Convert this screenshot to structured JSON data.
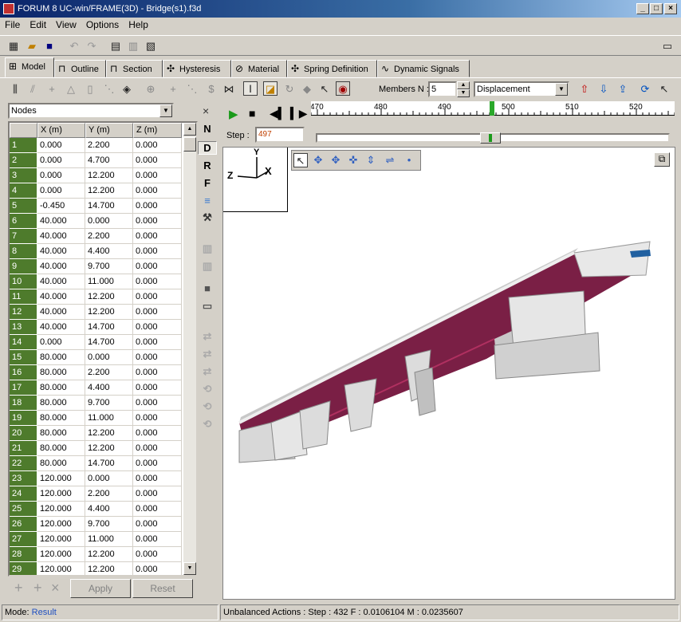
{
  "window": {
    "title": "FORUM 8  UC-win/FRAME(3D) - Bridge(s1).f3d"
  },
  "menu": [
    "File",
    "Edit",
    "View",
    "Options",
    "Help"
  ],
  "tabs": [
    "Model",
    "Outline",
    "Section",
    "Hysteresis",
    "Material",
    "Spring Definition",
    "Dynamic Signals"
  ],
  "toolbar2": {
    "members_label": "Members N :",
    "members_value": "5",
    "result_type": "Displacement"
  },
  "left": {
    "list_select": "Nodes",
    "close": "×",
    "columns": [
      "",
      "X (m)",
      "Y (m)",
      "Z (m)"
    ],
    "rows": [
      [
        "1",
        "0.000",
        "2.200",
        "0.000"
      ],
      [
        "2",
        "0.000",
        "4.700",
        "0.000"
      ],
      [
        "3",
        "0.000",
        "12.200",
        "0.000"
      ],
      [
        "4",
        "0.000",
        "12.200",
        "0.000"
      ],
      [
        "5",
        "-0.450",
        "14.700",
        "0.000"
      ],
      [
        "6",
        "40.000",
        "0.000",
        "0.000"
      ],
      [
        "7",
        "40.000",
        "2.200",
        "0.000"
      ],
      [
        "8",
        "40.000",
        "4.400",
        "0.000"
      ],
      [
        "9",
        "40.000",
        "9.700",
        "0.000"
      ],
      [
        "10",
        "40.000",
        "11.000",
        "0.000"
      ],
      [
        "11",
        "40.000",
        "12.200",
        "0.000"
      ],
      [
        "12",
        "40.000",
        "12.200",
        "0.000"
      ],
      [
        "13",
        "40.000",
        "14.700",
        "0.000"
      ],
      [
        "14",
        "0.000",
        "14.700",
        "0.000"
      ],
      [
        "15",
        "80.000",
        "0.000",
        "0.000"
      ],
      [
        "16",
        "80.000",
        "2.200",
        "0.000"
      ],
      [
        "17",
        "80.000",
        "4.400",
        "0.000"
      ],
      [
        "18",
        "80.000",
        "9.700",
        "0.000"
      ],
      [
        "19",
        "80.000",
        "11.000",
        "0.000"
      ],
      [
        "20",
        "80.000",
        "12.200",
        "0.000"
      ],
      [
        "21",
        "80.000",
        "12.200",
        "0.000"
      ],
      [
        "22",
        "80.000",
        "14.700",
        "0.000"
      ],
      [
        "23",
        "120.000",
        "0.000",
        "0.000"
      ],
      [
        "24",
        "120.000",
        "2.200",
        "0.000"
      ],
      [
        "25",
        "120.000",
        "4.400",
        "0.000"
      ],
      [
        "26",
        "120.000",
        "9.700",
        "0.000"
      ],
      [
        "27",
        "120.000",
        "11.000",
        "0.000"
      ],
      [
        "28",
        "120.000",
        "12.200",
        "0.000"
      ],
      [
        "29",
        "120.000",
        "12.200",
        "0.000"
      ]
    ],
    "apply": "Apply",
    "reset": "Reset"
  },
  "side_tools": [
    "N",
    "D",
    "R",
    "F"
  ],
  "player": {
    "step_label": "Step :",
    "step_value": "497"
  },
  "ruler": {
    "ticks": [
      "470",
      "480",
      "490",
      "500",
      "510",
      "520"
    ],
    "current_step": 497
  },
  "axes": {
    "y": "Y",
    "x": "X",
    "z": "Z"
  },
  "status": {
    "mode_label": "Mode:",
    "mode_value": "Result",
    "message": "Unbalanced Actions : Step : 432  F : 0.0106104  M : 0.0235607"
  },
  "colors": {
    "row_number_bg": "#4e7b2c",
    "deck": "#7a1f45",
    "pier": "#dcdcdc",
    "accent": "#0a246a"
  }
}
